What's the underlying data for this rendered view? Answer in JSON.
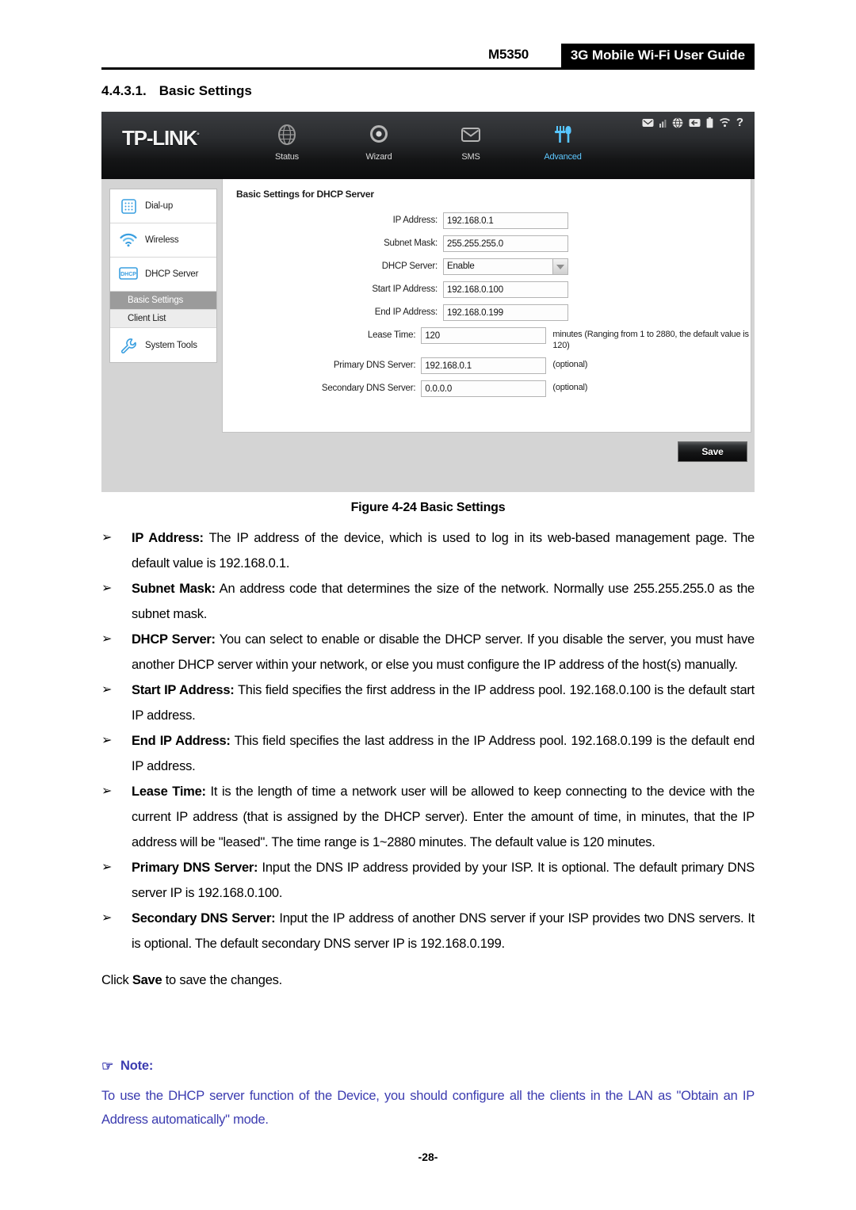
{
  "header": {
    "model": "M5350",
    "guide_title": "3G Mobile Wi-Fi User Guide"
  },
  "section": {
    "number": "4.4.3.1.",
    "title": "Basic Settings"
  },
  "device_ui": {
    "brand": "TP-LINK",
    "brand_mark": "°",
    "nav": [
      {
        "label": "Status",
        "icon": "globe-icon",
        "active": false
      },
      {
        "label": "Wizard",
        "icon": "target-icon",
        "active": false
      },
      {
        "label": "SMS",
        "icon": "envelope-icon",
        "active": false
      },
      {
        "label": "Advanced",
        "icon": "fork-knife-icon",
        "active": true
      }
    ],
    "statusbar_icons": [
      "message-icon",
      "signal-bars-icon",
      "globe-network-icon",
      "data-transfer-icon",
      "battery-icon",
      "wifi-icon",
      "help-icon"
    ],
    "sidebar": [
      {
        "label": "Dial-up",
        "icon": "keypad-icon"
      },
      {
        "label": "Wireless",
        "icon": "wifi-signal-icon"
      },
      {
        "label": "DHCP Server",
        "icon": "dhcp-icon"
      },
      {
        "label": "System Tools",
        "icon": "wrench-icon"
      }
    ],
    "sidebar_subitems": [
      {
        "label": "Basic Settings",
        "selected": true
      },
      {
        "label": "Client List",
        "selected": false
      }
    ],
    "panel_title": "Basic Settings for DHCP Server",
    "fields": [
      {
        "label": "IP Address:",
        "value": "192.168.0.1",
        "type": "text",
        "hint": ""
      },
      {
        "label": "Subnet Mask:",
        "value": "255.255.255.0",
        "type": "text",
        "hint": ""
      },
      {
        "label": "DHCP Server:",
        "value": "Enable",
        "type": "select",
        "hint": ""
      },
      {
        "label": "Start IP Address:",
        "value": "192.168.0.100",
        "type": "text",
        "hint": ""
      },
      {
        "label": "End IP Address:",
        "value": "192.168.0.199",
        "type": "text",
        "hint": ""
      },
      {
        "label": "Lease Time:",
        "value": "120",
        "type": "text",
        "hint": "minutes (Ranging from 1 to 2880, the default value is 120)"
      },
      {
        "label": "Primary DNS Server:",
        "value": "192.168.0.1",
        "type": "text",
        "hint": "(optional)"
      },
      {
        "label": "Secondary DNS Server:",
        "value": "0.0.0.0",
        "type": "text",
        "hint": "(optional)"
      }
    ],
    "save_label": "Save",
    "accent_color": "#5ec8ff",
    "selected_item_bg": "#9b9b9b"
  },
  "figure_caption": "Figure 4-24 Basic Settings",
  "bullets": [
    {
      "marker": "➢",
      "term": "IP Address:",
      "text": " The IP address of the device, which is used to log in its web-based management page. The default value is 192.168.0.1."
    },
    {
      "marker": "➢",
      "term": "Subnet Mask:",
      "text": " An address code that determines the size of the network. Normally use 255.255.255.0 as the subnet mask."
    },
    {
      "marker": "➢",
      "term": "DHCP Server:",
      "text": " You can select to enable or disable the DHCP server. If you disable the server, you must have another DHCP server within your network, or else you must configure the IP address of the host(s) manually."
    },
    {
      "marker": "➢",
      "term": "Start IP Address:",
      "text": " This field specifies the first address in the IP address pool. 192.168.0.100 is the default start IP address."
    },
    {
      "marker": "➢",
      "term": "End IP Address:",
      "text": " This field specifies the last address in the IP Address pool. 192.168.0.199 is the default end IP address."
    },
    {
      "marker": "➢",
      "term": "Lease Time:",
      "text": " It is the length of time a network user will be allowed to keep connecting to the device with the current IP address (that is assigned by the DHCP server). Enter the amount of time, in minutes, that the IP address will be \"leased\". The time range is 1~2880 minutes. The default value is 120 minutes."
    },
    {
      "marker": "➢",
      "term": "Primary DNS Server:",
      "text": " Input the DNS IP address provided by your ISP. It is optional. The default primary DNS server IP is 192.168.0.100."
    },
    {
      "marker": "➢",
      "term": "Secondary DNS Server:",
      "text": " Input the IP address of another DNS server if your ISP provides two DNS servers. It is optional. The default secondary DNS server IP is 192.168.0.199."
    }
  ],
  "click_save": {
    "prefix": "Click ",
    "bold": "Save",
    "suffix": " to save the changes."
  },
  "note": {
    "hand": "☞",
    "heading": "Note:",
    "body": "To use the DHCP server function of the Device, you should configure all the clients in the LAN as \"Obtain an IP Address automatically\" mode.",
    "color": "#3b3bb0"
  },
  "footer": {
    "page_number": "-28-"
  }
}
